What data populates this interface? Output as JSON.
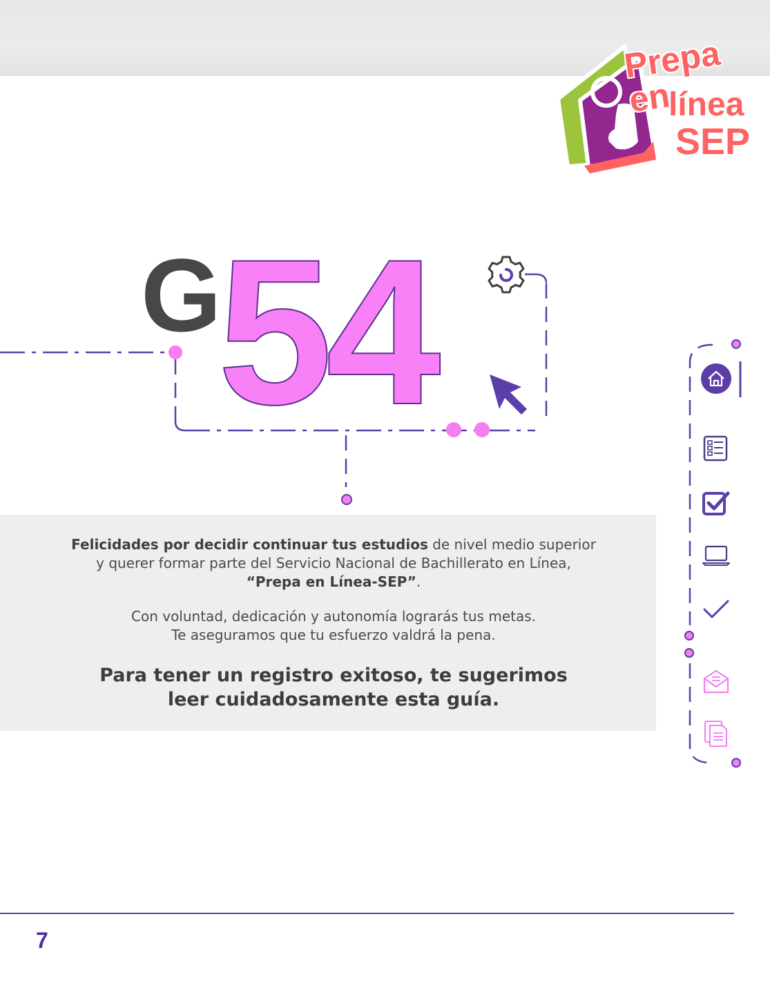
{
  "header": {
    "logo_line1": "Prepa en",
    "logo_line2": "línea",
    "logo_line3": "SEP",
    "logo_colors": {
      "green": "#9bc43c",
      "purple": "#93268f",
      "coral": "#ff6262"
    }
  },
  "hero": {
    "letter": "G",
    "number": "54",
    "icons": [
      "gear-icon",
      "cursor-arrow-icon"
    ],
    "colors": {
      "number_fill": "#f981f8",
      "outline": "#5b2e8f",
      "letter": "#474747",
      "accent": "#5b3ea8"
    }
  },
  "message": {
    "p1_bold": "Felicidades por decidir continuar tus estudios",
    "p1_rest": " de nivel medio superior",
    "p1_line2": "y querer formar parte del Servicio Nacional de Bachillerato en Línea,",
    "p1_line3_bold": "“Prepa en Línea-SEP”",
    "p1_line3_end": ".",
    "p2_line1": "Con voluntad, dedicación y autonomía lograrás tus metas.",
    "p2_line2": "Te aseguramos que tu esfuerzo valdrá la pena.",
    "p3_line1": "Para tener un registro exitoso, te sugerimos",
    "p3_line2": "leer cuidadosamente esta guía."
  },
  "sidebar": {
    "icons": [
      "home-icon",
      "checklist-icon",
      "checkbox-icon",
      "laptop-icon",
      "checkmark-icon",
      "envelope-icon",
      "documents-icon"
    ],
    "active": "home-icon"
  },
  "footer": {
    "page_number": "7"
  }
}
